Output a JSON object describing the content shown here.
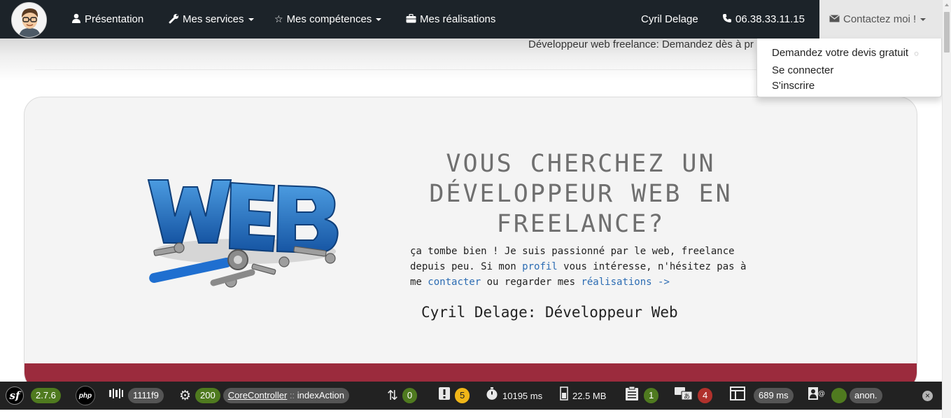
{
  "navbar": {
    "items": [
      {
        "label": "Présentation",
        "icon": "user-icon"
      },
      {
        "label": "Mes services",
        "icon": "wrench-icon"
      },
      {
        "label": "Mes compétences",
        "icon": "star-icon"
      },
      {
        "label": "Mes réalisations",
        "icon": "briefcase-icon"
      }
    ],
    "name": "Cyril Delage",
    "phone": "06.38.33.11.15",
    "contact_label": "Contactez moi !"
  },
  "banner": {
    "tagline": "Développeur web freelance: Demandez dès à pr"
  },
  "dropdown": {
    "items": [
      "Demandez votre devis gratuit",
      "Se connecter",
      "S'inscrire"
    ]
  },
  "hero": {
    "title_lines": [
      "VOUS CHERCHEZ UN",
      "DÉVELOPPEUR WEB EN",
      "FREELANCE?"
    ],
    "text_part1": "ça tombe bien ! Je suis passionné par le web, freelance depuis peu. Si mon ",
    "link_profil": "profil",
    "text_part2": " vous intéresse, n'hésitez pas à me ",
    "link_contact": "contacter",
    "text_part3": " ou regarder mes ",
    "link_realisations": "réalisations ->",
    "signature": "Cyril Delage: Développeur Web",
    "image_label": "WEB"
  },
  "sf_toolbar": {
    "symfony_version": "2.7.6",
    "php_label": "php",
    "token": "1111f9",
    "status_code": "200",
    "controller": "CoreController",
    "action_sep": " :: ",
    "action": "indexAction",
    "ajax_count": "0",
    "log_count": "5",
    "time": "10195 ms",
    "memory": "22.5 MB",
    "forms_count": "1",
    "translation_count": "4",
    "twig_time": "689 ms",
    "user": "anon.",
    "colors": {
      "bg": "#222222",
      "green": "#4f7a1f",
      "yellow": "#f0b618",
      "red": "#b0312c"
    }
  }
}
